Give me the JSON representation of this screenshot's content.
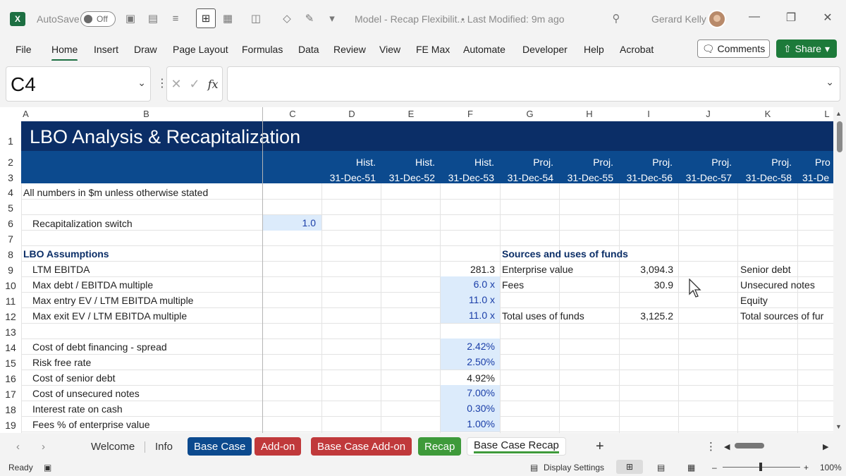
{
  "titlebar": {
    "autosave_label": "AutoSave",
    "autosave_state": "Off",
    "doc_title": "Model - Recap Flexibilit...",
    "last_modified": "• Last Modified: 9m ago",
    "user_name": "Gerard Kelly",
    "app_logo": "X"
  },
  "ribbon": {
    "tabs": [
      "File",
      "Home",
      "Insert",
      "Draw",
      "Page Layout",
      "Formulas",
      "Data",
      "Review",
      "View",
      "FE Max",
      "Automate",
      "Developer",
      "Help",
      "Acrobat"
    ],
    "active_tab": "Home",
    "comments_label": "Comments",
    "share_label": "Share"
  },
  "formula_bar": {
    "name_box": "C4",
    "fx_label": "fx",
    "formula": ""
  },
  "columns": [
    "A",
    "B",
    "C",
    "D",
    "E",
    "F",
    "G",
    "H",
    "I",
    "J",
    "K",
    "L"
  ],
  "rows": [
    "1",
    "2",
    "3",
    "4",
    "5",
    "6",
    "7",
    "8",
    "9",
    "10",
    "11",
    "12",
    "13",
    "14",
    "15",
    "16",
    "17",
    "18",
    "19"
  ],
  "sheet": {
    "title": "LBO Analysis & Recapitalization",
    "period_types": [
      "Hist.",
      "Hist.",
      "Hist.",
      "Proj.",
      "Proj.",
      "Proj.",
      "Proj.",
      "Proj.",
      "Pro"
    ],
    "period_dates": [
      "31-Dec-51",
      "31-Dec-52",
      "31-Dec-53",
      "31-Dec-54",
      "31-Dec-55",
      "31-Dec-56",
      "31-Dec-57",
      "31-Dec-58",
      "31-De"
    ],
    "units_note": "All numbers in $m unless otherwise stated",
    "recap_switch_label": "Recapitalization switch",
    "recap_switch_value": "1.0",
    "lbo_header": "LBO Assumptions",
    "assumptions": [
      {
        "label": "LTM EBITDA",
        "value": "281.3"
      },
      {
        "label": "Max debt / EBITDA multiple",
        "value": "6.0 x"
      },
      {
        "label": "Max entry EV / LTM EBITDA multiple",
        "value": "11.0 x"
      },
      {
        "label": "Max exit EV / LTM EBITDA multiple",
        "value": "11.0 x"
      },
      {
        "label": "Cost of debt financing - spread",
        "value": "2.42%"
      },
      {
        "label": "Risk free rate",
        "value": "2.50%"
      },
      {
        "label": "Cost of senior debt",
        "value": "4.92%"
      },
      {
        "label": "Cost of unsecured notes",
        "value": "7.00%"
      },
      {
        "label": "Interest rate on cash",
        "value": "0.30%"
      },
      {
        "label": "Fees % of enterprise value",
        "value": "1.00%"
      }
    ],
    "sources_uses_header": "Sources and uses of funds",
    "uses": [
      {
        "label": "Enterprise value",
        "value": "3,094.3"
      },
      {
        "label": "Fees",
        "value": "30.9"
      },
      {
        "label": "Total uses of funds",
        "value": "3,125.2"
      }
    ],
    "sources": [
      "Senior debt",
      "Unsecured notes",
      "Equity",
      "Total sources of fur"
    ]
  },
  "sheet_tabs": [
    "Welcome",
    "Info",
    "Base Case",
    "Add-on",
    "Base Case Add-on",
    "Recap",
    "Base Case Recap"
  ],
  "statusbar": {
    "ready": "Ready",
    "display_settings": "Display Settings",
    "zoom": "100%",
    "zoom_level": 1.0
  },
  "colors": {
    "title_band": "#0b2e67",
    "header_band": "#0c4a8e",
    "input_fill": "#dcebfb",
    "excel_green": "#1d6f42"
  }
}
